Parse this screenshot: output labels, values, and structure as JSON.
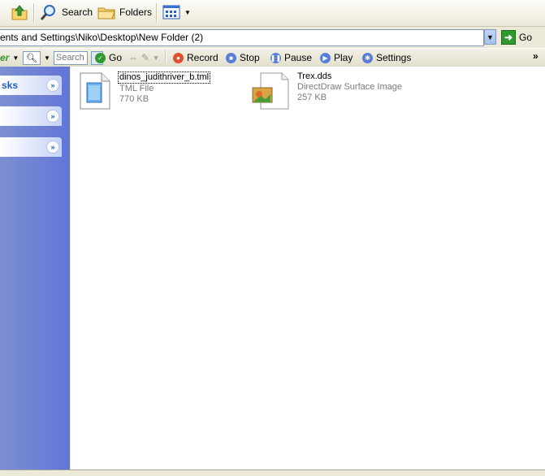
{
  "toolbar": {
    "search_label": "Search",
    "folders_label": "Folders"
  },
  "address": {
    "path": "ents and Settings\\Niko\\Desktop\\New Folder (2)",
    "go_label": "Go"
  },
  "linkbar": {
    "partial_label": "er",
    "search_placeholder": "Search",
    "go_label": "Go",
    "record_label": "Record",
    "stop_label": "Stop",
    "pause_label": "Pause",
    "play_label": "Play",
    "settings_label": "Settings",
    "overflow": "»"
  },
  "sidebar": {
    "panels": [
      {
        "label": "sks"
      },
      {
        "label": ""
      },
      {
        "label": ""
      }
    ]
  },
  "files": [
    {
      "name": "dinos_judithriver_b.tml",
      "type": "TML File",
      "size": "770 KB",
      "icon": "tml-file-icon"
    },
    {
      "name": "Trex.dds",
      "type": "DirectDraw Surface Image",
      "size": "257 KB",
      "icon": "dds-image-icon"
    }
  ],
  "colors": {
    "sidebar": "#6375d6",
    "panel_label": "#215dc6",
    "record": "#e05030",
    "go_green": "#2e9a2e"
  }
}
